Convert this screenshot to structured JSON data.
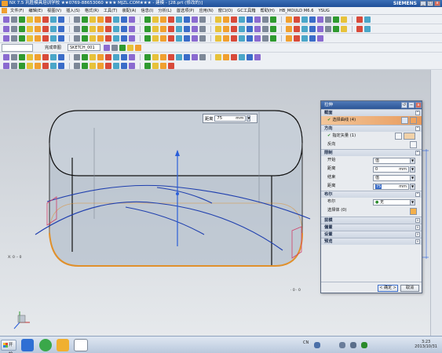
{
  "window": {
    "title": "NX 7.5 巩胜模具培训学校 ★★0769-88653060 ★★★ MJZL.COM★★★ - 建模 - [28.prt (修改的)]",
    "brand": "SIEMENS",
    "buttons": {
      "minimize": "_",
      "maximize": "□",
      "close": "x"
    }
  },
  "menubar": {
    "items": [
      "文件(F)",
      "编辑(E)",
      "视图(V)",
      "插入(S)",
      "格式(R)",
      "工具(T)",
      "装配(A)",
      "信息(I)",
      "分析(L)",
      "首选项(P)",
      "应用(N)",
      "窗口(O)",
      "GC工具箱",
      "帮助(H)",
      "HB_MOULD M6.6",
      "YSUG"
    ]
  },
  "selection": {
    "sketch_label": "完成草图",
    "sketch_name": "SKETCH_001"
  },
  "viewport": {
    "distance_label": "距离",
    "distance_value": "75",
    "distance_unit": "mm",
    "axis_label_left": "X: 0 ·· 0",
    "axis_label_bottom": "· 0 · 0"
  },
  "dialog": {
    "title": "拉伸",
    "section_section": "截面",
    "select_curve": "选择曲线 (4)",
    "section_direction": "方向",
    "specify_vector": "指定矢量 (1)",
    "reverse": "反向",
    "section_limits": "限制",
    "start_label": "开始",
    "start_value": "值",
    "distance1_label": "距离",
    "distance1_value": "0",
    "end_label": "结束",
    "end_value": "值",
    "distance2_label": "距离",
    "distance2_value": "75",
    "unit": "mm",
    "section_boolean": "布尔",
    "boolean_label": "布尔",
    "boolean_value": "无",
    "select_body": "选择体 (0)",
    "section_draft": "拔模",
    "section_offset": "偏置",
    "section_settings": "设置",
    "section_preview": "预览",
    "ok": "< 确定 >",
    "cancel": "取消"
  },
  "taskbar": {
    "start": "开始",
    "lang": "CN",
    "time": "3:23",
    "date": "2013/10/31"
  },
  "colors": {
    "title_bar": "#2c5596",
    "highlight_row": "#e89a5b",
    "body_fill": "#b9c3cf",
    "curve_blue": "#1f3fae",
    "edge_orange": "#e0902b"
  }
}
